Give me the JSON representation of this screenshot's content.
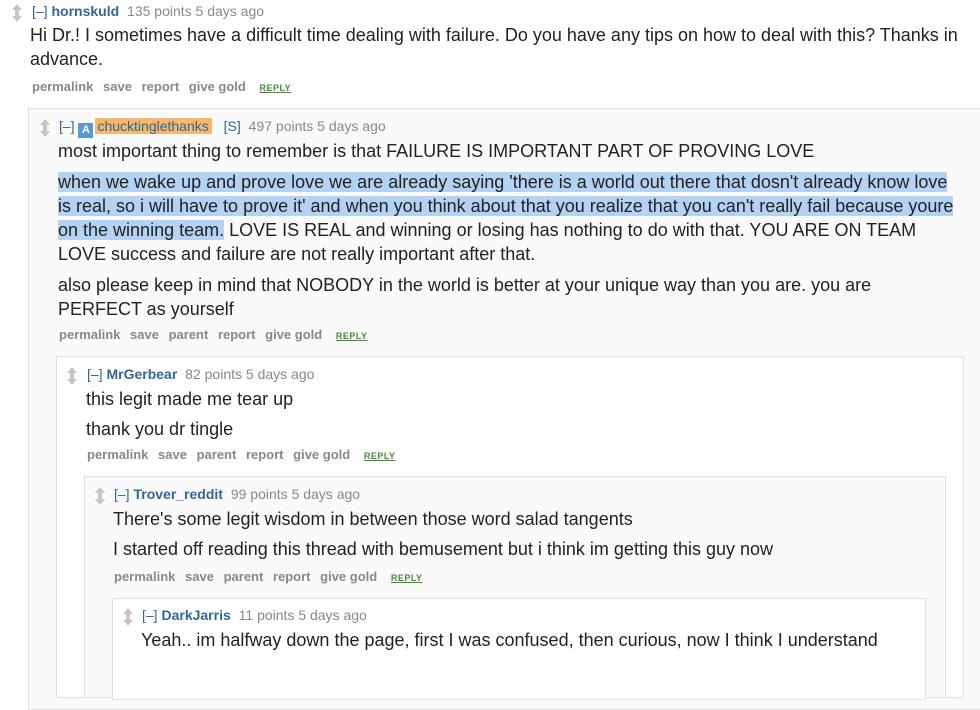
{
  "comments": [
    {
      "author": "hornskuld",
      "score": "135 points",
      "age": "5 days ago",
      "paragraphs": [
        "Hi Dr.! I sometimes have a difficult time dealing with failure. Do you have any tips on how to deal with this? Thanks in advance."
      ],
      "buttons": [
        "permalink",
        "save",
        "report",
        "give gold"
      ]
    },
    {
      "author": "chucktinglethanks",
      "op_icon": "A",
      "submitter": "[S]",
      "score": "497 points",
      "age": "5 days ago",
      "p1": "most important thing to remember is that FAILURE IS IMPORTANT PART OF PROVING LOVE",
      "p2_highlight": "when we wake up and prove love we are already saying 'there is a world out there that dosn't already know love is real, so i will have to prove it' and when you think about that you realize that you can't really fail because youre on the winning team.",
      "p2_rest": " LOVE IS REAL and winning or losing has nothing to do with that. YOU ARE ON TEAM LOVE success and failure are not really important after that.",
      "p3": "also please keep in mind that NOBODY in the world is better at your unique way than you are. you are PERFECT as yourself",
      "buttons": [
        "permalink",
        "save",
        "parent",
        "report",
        "give gold"
      ]
    },
    {
      "author": "MrGerbear",
      "score": "82 points",
      "age": "5 days ago",
      "paragraphs": [
        "this legit made me tear up",
        "thank you dr tingle"
      ],
      "buttons": [
        "permalink",
        "save",
        "parent",
        "report",
        "give gold"
      ]
    },
    {
      "author": "Trover_reddit",
      "score": "99 points",
      "age": "5 days ago",
      "paragraphs": [
        "There's some legit wisdom in between those word salad tangents",
        "I started off reading this thread with bemusement but i think im getting this guy now"
      ],
      "buttons": [
        "permalink",
        "save",
        "parent",
        "report",
        "give gold"
      ]
    },
    {
      "author": "DarkJarris",
      "score": "11 points",
      "age": "5 days ago",
      "paragraphs": [
        "Yeah.. im halfway down the page, first I was confused, then curious, now I think I understand"
      ]
    }
  ],
  "ui": {
    "collapse": "[–]",
    "reply": "REPLY"
  }
}
